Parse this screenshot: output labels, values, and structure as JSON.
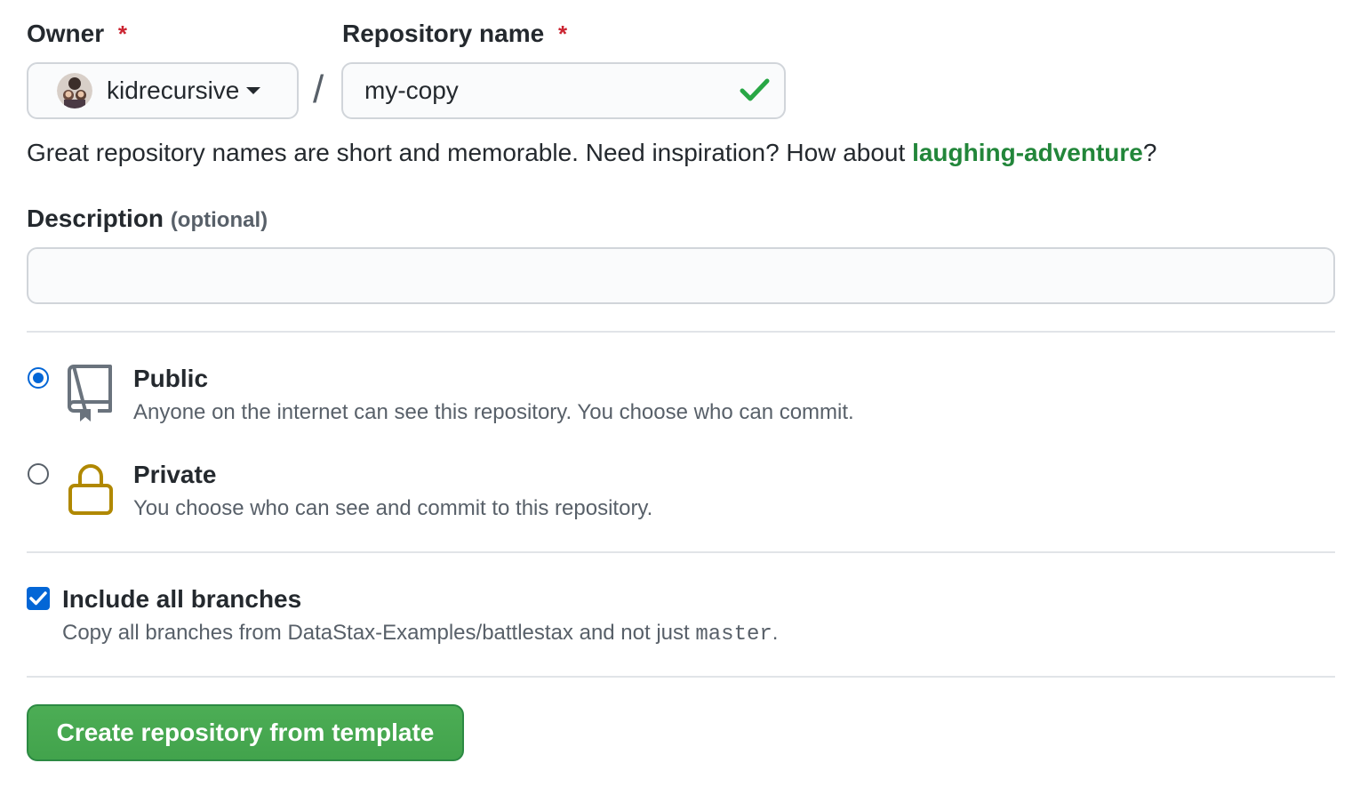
{
  "owner": {
    "label": "Owner",
    "required_mark": "*",
    "selected": "kidrecursive",
    "avatar_icon": "user-avatar",
    "dropdown_icon": "caret-down-icon"
  },
  "repo": {
    "label": "Repository name",
    "required_mark": "*",
    "value": "my-copy",
    "valid": true,
    "status_icon": "check-icon"
  },
  "separator": "/",
  "name_hint": {
    "prefix": "Great repository names are short and memorable. Need inspiration? How about ",
    "suggestion": "laughing-adventure",
    "suffix": "?"
  },
  "description": {
    "label": "Description",
    "optional_tag": "(optional)",
    "value": ""
  },
  "visibility": {
    "selected": "public",
    "options": [
      {
        "id": "public",
        "title": "Public",
        "desc": "Anyone on the internet can see this repository. You choose who can commit.",
        "icon": "repo-book-icon"
      },
      {
        "id": "private",
        "title": "Private",
        "desc": "You choose who can see and commit to this repository.",
        "icon": "lock-icon"
      }
    ]
  },
  "branches": {
    "checked": true,
    "label": "Include all branches",
    "desc_prefix": "Copy all branches from DataStax-Examples/battlestax and not just ",
    "desc_code": "master",
    "desc_suffix": "."
  },
  "submit": {
    "label": "Create repository from template"
  },
  "colors": {
    "accent_blue": "#0366d6",
    "success_green": "#28a745",
    "required_red": "#cb2431",
    "lock_gold": "#b08800"
  }
}
